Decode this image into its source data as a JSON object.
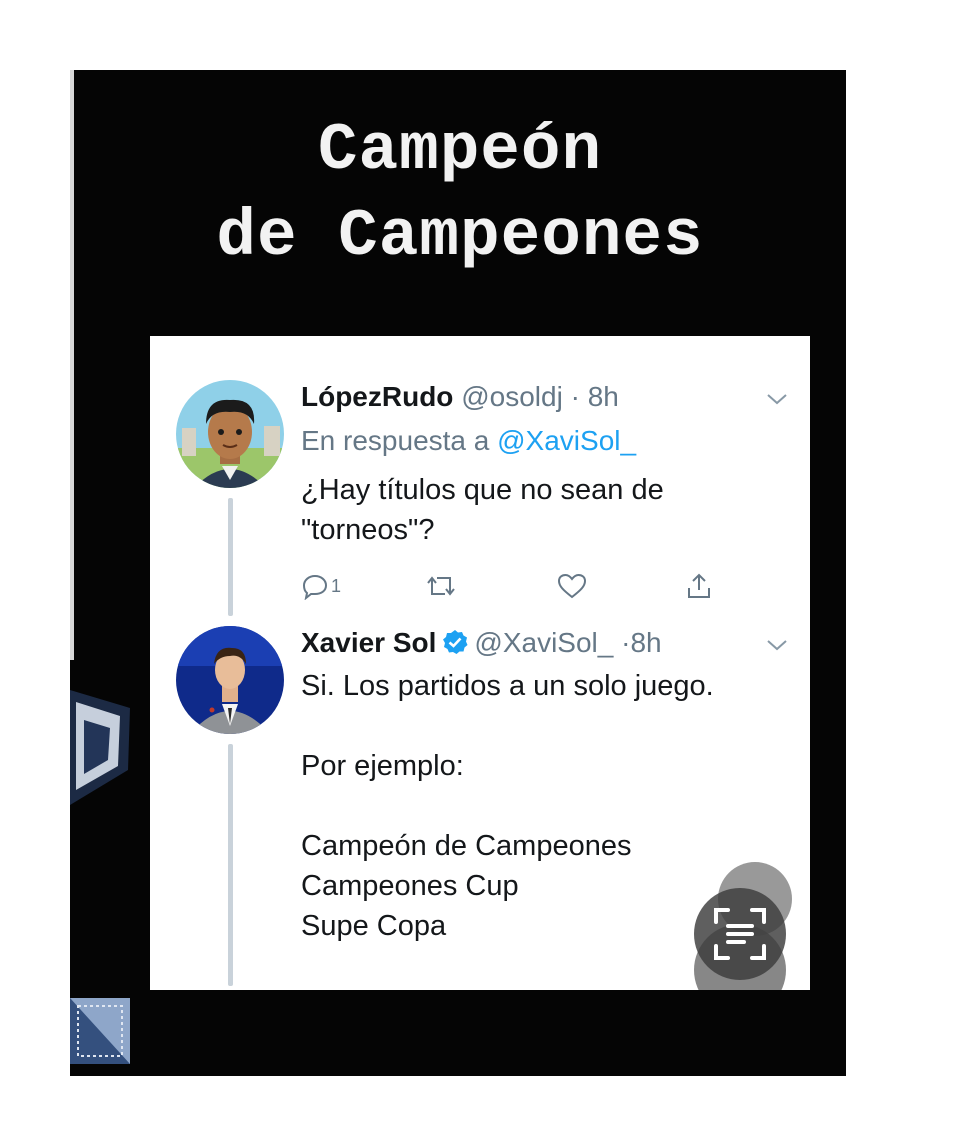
{
  "caption": {
    "line1": "Campeón",
    "line2": "de Campeones"
  },
  "tweets": [
    {
      "name": "LópezRudo",
      "handle": "@osoldj",
      "separator": "·",
      "time": "8h",
      "reply_prefix": "En respuesta a",
      "reply_to": "@XaviSol_",
      "text_lines": [
        "¿Hay títulos que no sean de",
        "\"torneos\"?"
      ],
      "reply_count": "1",
      "icons": [
        "reply-icon",
        "retweet-icon",
        "like-icon",
        "share-icon"
      ]
    },
    {
      "name": "Xavier Sol",
      "verified": true,
      "handle": "@XaviSol_",
      "separator": "·",
      "time": "8h",
      "text_lines": [
        "Si. Los partidos a un solo juego.",
        "",
        "Por ejemplo:",
        "",
        "Campeón de Campeones",
        "Campeones Cup",
        "Supe Copa"
      ]
    }
  ],
  "colors": {
    "background": "#050505",
    "caption": "#f2f2f2",
    "link": "#1da1f2",
    "verified": "#1da1f2",
    "secondary_text": "#657786",
    "thread_line": "#c9d2da"
  },
  "overlay": {
    "icons": [
      "text-scan-icon"
    ]
  }
}
